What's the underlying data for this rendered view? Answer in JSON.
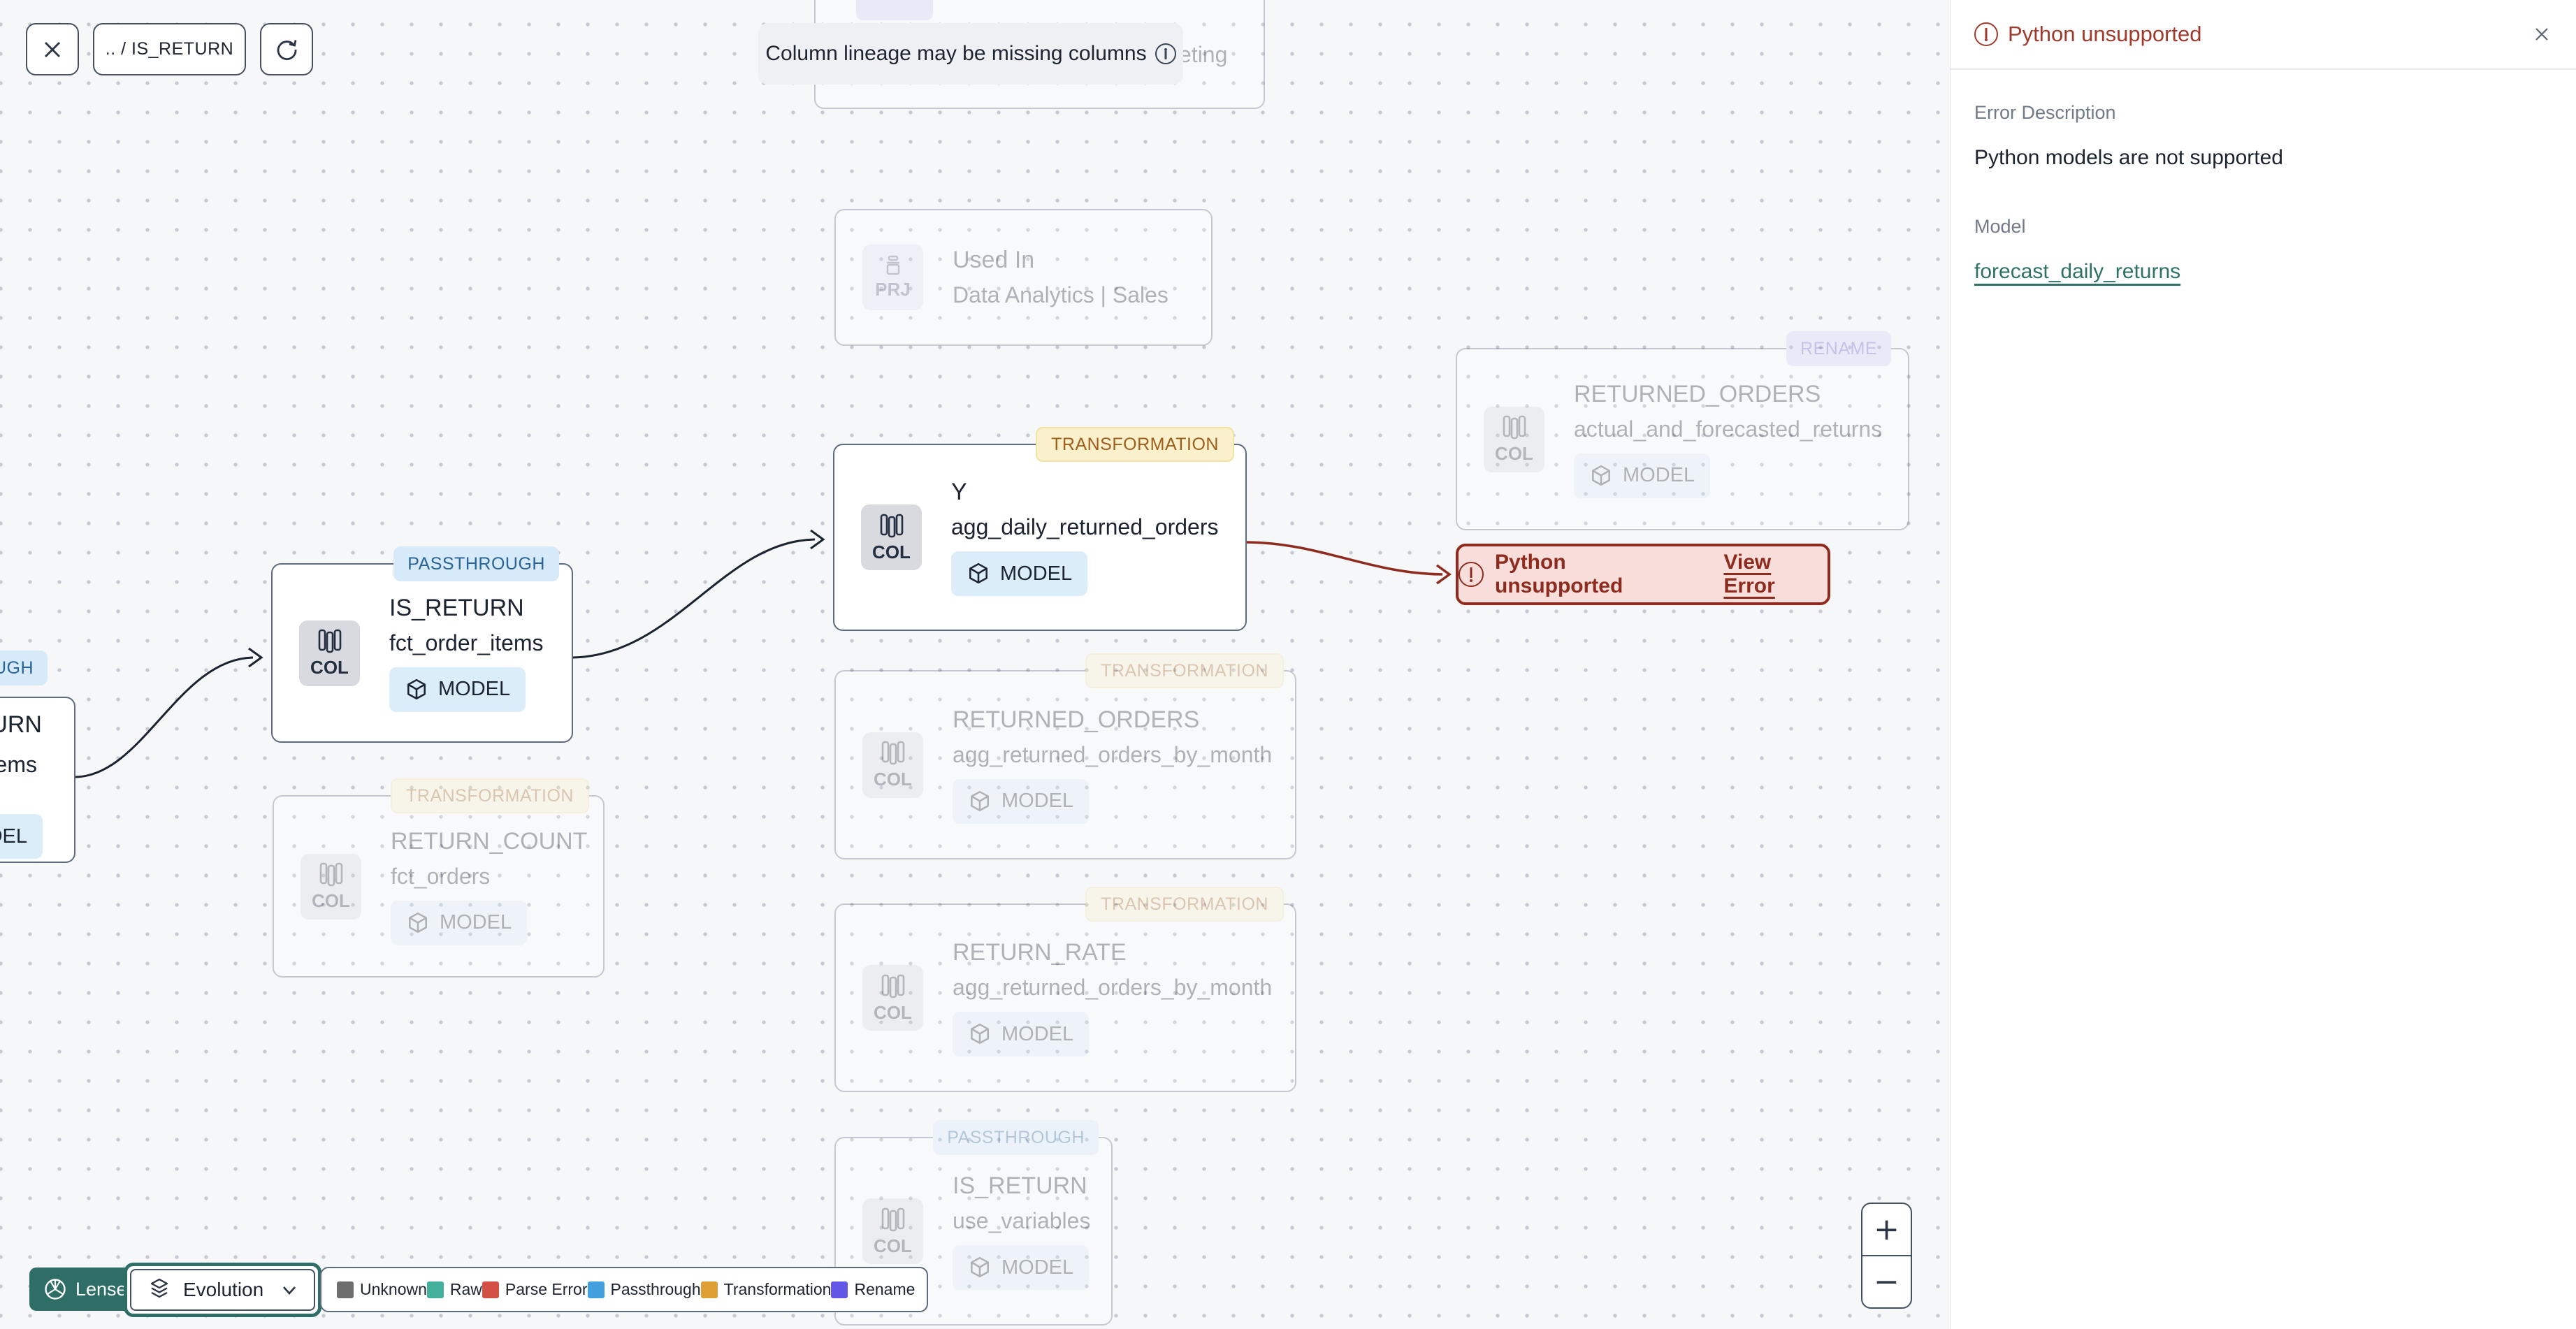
{
  "toolbar": {
    "breadcrumb": ".. / IS_RETURN"
  },
  "banner": {
    "text": "Column lineage may be missing columns"
  },
  "canvas": {
    "nodes": {
      "left_partial": {
        "badge": "OUGH",
        "title": "URN",
        "subtitle": "ems",
        "model_label": "DEL"
      },
      "fct_order_items": {
        "badge": "PASSTHROUGH",
        "col_label": "COL",
        "title": "IS_RETURN",
        "subtitle": "fct_order_items",
        "model_label": "MODEL"
      },
      "agg_daily": {
        "badge": "TRANSFORMATION",
        "col_label": "COL",
        "title": "Y",
        "subtitle": "agg_daily_returned_orders",
        "model_label": "MODEL"
      },
      "used_in_sales": {
        "prj_label": "PRJ",
        "title": "Used In",
        "subtitle": "Data Analytics | Sales"
      },
      "marketing_partial": {
        "fragment": "eting",
        "badge": ""
      },
      "actual_forecasted": {
        "badge": "RENAME",
        "col_label": "COL",
        "title": "RETURNED_ORDERS",
        "subtitle": "actual_and_forecasted_returns",
        "model_label": "MODEL"
      },
      "agg_by_month": {
        "badge": "TRANSFORMATION",
        "col_label": "COL",
        "title": "RETURNED_ORDERS",
        "subtitle": "agg_returned_orders_by_month",
        "model_label": "MODEL"
      },
      "return_rate": {
        "badge": "TRANSFORMATION",
        "col_label": "COL",
        "title": "RETURN_RATE",
        "subtitle": "agg_returned_orders_by_month",
        "model_label": "MODEL"
      },
      "use_variables": {
        "badge": "PASSTHROUGH",
        "col_label": "COL",
        "title": "IS_RETURN",
        "subtitle": "use_variables",
        "model_label": "MODEL"
      },
      "return_count": {
        "badge": "TRANSFORMATION",
        "col_label": "COL",
        "title": "RETURN_COUNT",
        "subtitle": "fct_orders",
        "model_label": "MODEL"
      }
    },
    "error_badge": {
      "label": "Python unsupported",
      "link": "View Error"
    }
  },
  "sidebar": {
    "title": "Python unsupported",
    "error_description_label": "Error Description",
    "error_description": "Python models are not supported",
    "model_label": "Model",
    "model_link": "forecast_daily_returns"
  },
  "lenses": {
    "label": "Lenses",
    "selected_lens": "Evolution"
  },
  "legend": {
    "items": [
      {
        "label": "Unknown",
        "color": "#6E6E6E"
      },
      {
        "label": "Raw",
        "color": "#44AF9B"
      },
      {
        "label": "Parse Error",
        "color": "#D25044"
      },
      {
        "label": "Passthrough",
        "color": "#41A0DD"
      },
      {
        "label": "Transformation",
        "color": "#DD9F33"
      },
      {
        "label": "Rename",
        "color": "#6355E5"
      }
    ]
  },
  "zoom_controls": {
    "zoom_in": "+",
    "zoom_out": "−"
  },
  "colors": {
    "accent_teal": "#2E6E66",
    "error_red": "#8E2B1E",
    "edge_dark": "#1A2330"
  }
}
